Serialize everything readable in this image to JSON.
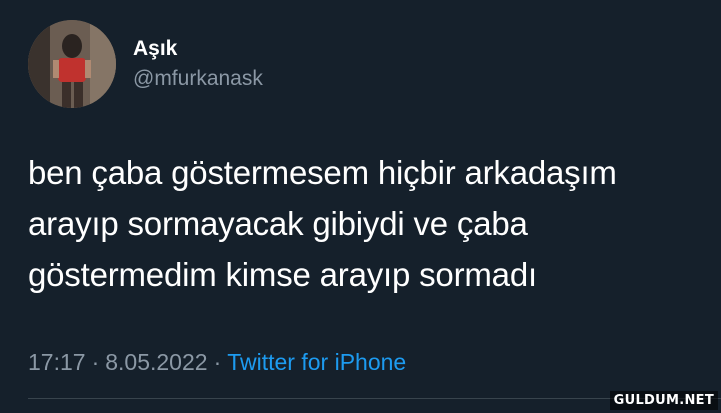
{
  "author": {
    "display_name": "Aşık",
    "handle": "@mfurkanask"
  },
  "tweet": {
    "lines": [
      "ben çaba göstermesem hiçbir arkadaşım",
      "arayıp sormayacak gibiydi ve çaba",
      "göstermedim kimse arayıp sormadı"
    ],
    "time": "17:17",
    "separator": "·",
    "date": "8.05.2022",
    "source": "Twitter for iPhone"
  },
  "watermark": "GULDUM.NET",
  "colors": {
    "background": "#15202b",
    "text": "#ffffff",
    "secondary": "#8b98a5",
    "link": "#1d9bf0"
  }
}
